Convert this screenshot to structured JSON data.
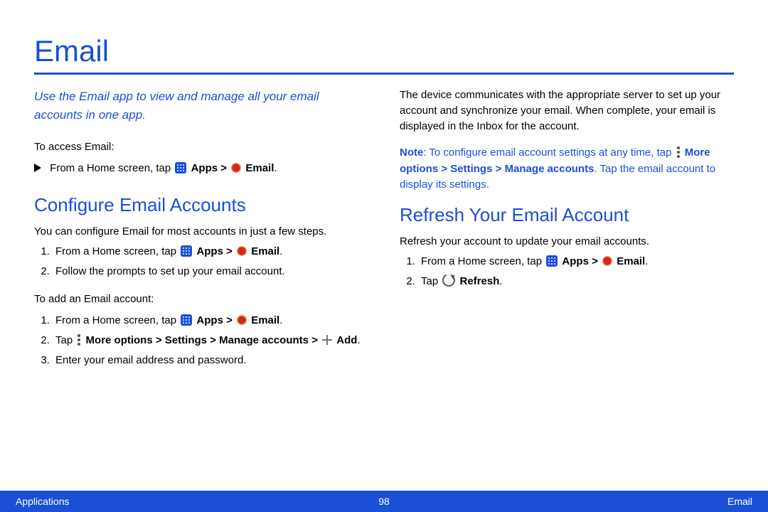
{
  "title": "Email",
  "intro": "Use the Email app to view and manage all your email accounts in one app.",
  "access_label": "To access Email:",
  "from_home_prefix": "From a Home screen, tap ",
  "apps_label": "Apps",
  "gt": " > ",
  "email_label": "Email",
  "period": ".",
  "h_configure": "Configure Email Accounts",
  "configure_body": "You can configure Email for most accounts in just a few steps.",
  "step_follow": "Follow the prompts to set up your email account.",
  "add_label": "To add an Email account:",
  "tap_prefix": "Tap ",
  "more_options": "More options",
  "settings": "Settings",
  "manage_accounts": "Manage accounts",
  "add": "Add",
  "step_enter": "Enter your email address and password.",
  "col2_p1": "The device communicates with the appropriate server to set up your account and synchronize your email. When complete, your email is displayed in the Inbox for the account.",
  "note_prefix": "Note",
  "note_body1": ": To configure email account settings at any time, tap ",
  "note_body2": ". Tap the email account to display its settings.",
  "h_refresh": "Refresh Your Email Account",
  "refresh_body": "Refresh your account to update your email accounts.",
  "refresh_label": "Refresh",
  "footer_left": "Applications",
  "footer_page": "98",
  "footer_right": "Email"
}
